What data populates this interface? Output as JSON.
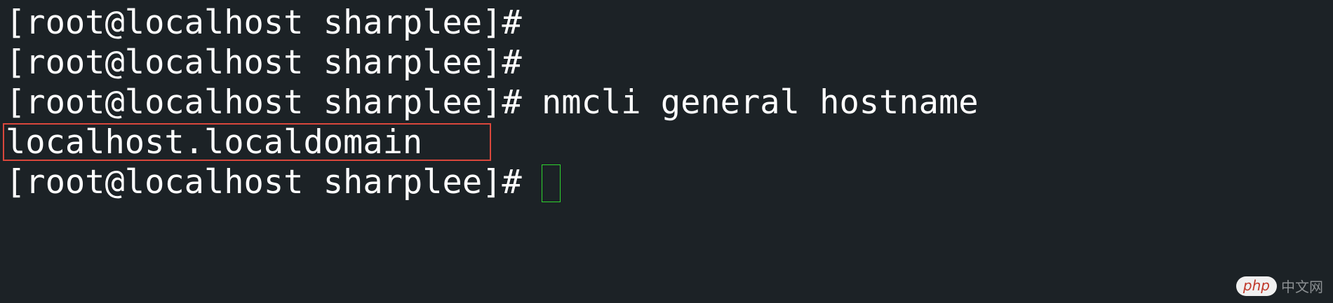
{
  "terminal": {
    "lines": [
      {
        "prompt": "[root@localhost sharplee]#",
        "command": ""
      },
      {
        "prompt": "[root@localhost sharplee]#",
        "command": ""
      },
      {
        "prompt": "[root@localhost sharplee]#",
        "command": " nmcli general hostname"
      },
      {
        "output": "localhost.localdomain"
      },
      {
        "prompt": "[root@localhost sharplee]#",
        "command": " "
      }
    ]
  },
  "colors": {
    "background": "#1c2226",
    "text": "#ffffff",
    "highlight": "#d9473c",
    "cursor": "#2ed42e"
  },
  "watermark": {
    "badge": "php",
    "text": "中文网"
  }
}
